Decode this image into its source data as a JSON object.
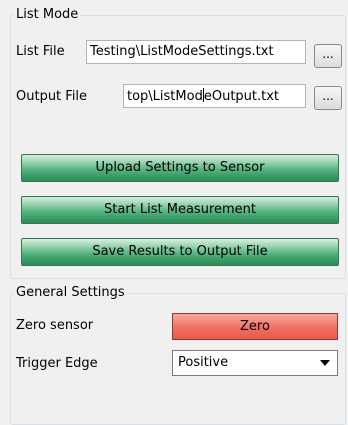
{
  "list_mode": {
    "title": "List Mode",
    "list_file": {
      "label": "List File",
      "value": "Testing\\ListModeSettings.txt",
      "browse_label": "..."
    },
    "output_file": {
      "label": "Output File",
      "value_before_cursor": "top\\ListMod",
      "value_after_cursor": "eOutput.txt",
      "browse_label": "..."
    },
    "buttons": {
      "upload": "Upload Settings to Sensor",
      "start": "Start List Measurement",
      "save": "Save Results to Output File"
    },
    "colors": {
      "button_green": "#58b583"
    }
  },
  "general_settings": {
    "title": "General Settings",
    "zero_sensor": {
      "label": "Zero sensor",
      "button_label": "Zero",
      "button_color": "#ef6c5f"
    },
    "trigger_edge": {
      "label": "Trigger Edge",
      "selected": "Positive",
      "icon": "chevron-down-icon"
    }
  }
}
